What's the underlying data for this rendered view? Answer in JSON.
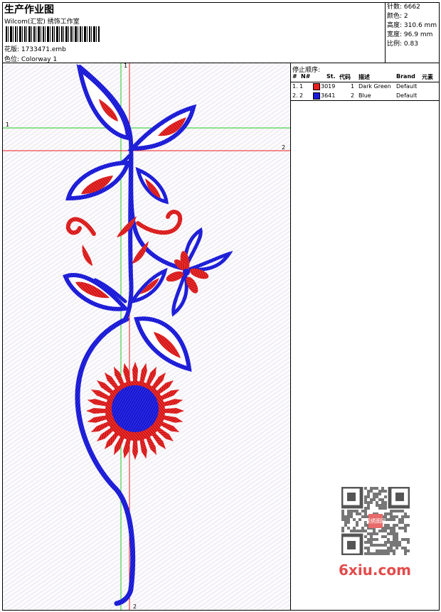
{
  "header": {
    "title": "生产作业图",
    "subtitle": "Wilcom(汇宏) 绣饰工作室",
    "design_label": "花版:",
    "design_file": "1733471.emb",
    "colorway_label": "色位:",
    "colorway_name": "Colorway 1"
  },
  "stats": {
    "stitches_label": "针数:",
    "stitches": "6662",
    "colors_label": "颜色:",
    "colors": "2",
    "height_label": "高度:",
    "height": "310.6 mm",
    "width_label": "宽度:",
    "width": "96.9 mm",
    "ratio_label": "比例:",
    "ratio": "0.83"
  },
  "canvas": {
    "guide_green_v_label": "1",
    "guide_green_h_label": "1",
    "guide_red_h_label": "2",
    "guide_red_v_label": "2",
    "colors": {
      "blue": "#1a1adc",
      "red": "#e82020",
      "green": "#22cc22",
      "guide_red": "#e82020"
    }
  },
  "stop_sequence": {
    "title": "停止顺序:",
    "headers": [
      "#",
      "N#",
      "St.",
      "代码",
      "描述",
      "Brand",
      "元素"
    ],
    "rows": [
      {
        "index": "1.",
        "n": "1",
        "color": "#e82020",
        "code": "3019",
        "st": "1",
        "desc": "Dark Green",
        "brand": "Default"
      },
      {
        "index": "2.",
        "n": "2",
        "color": "#1a1adc",
        "code": "3641",
        "st": "2",
        "desc": "Blue",
        "brand": "Default"
      }
    ]
  },
  "watermark": {
    "text": "6xiu.com",
    "qr_label": "汉绣图网"
  }
}
